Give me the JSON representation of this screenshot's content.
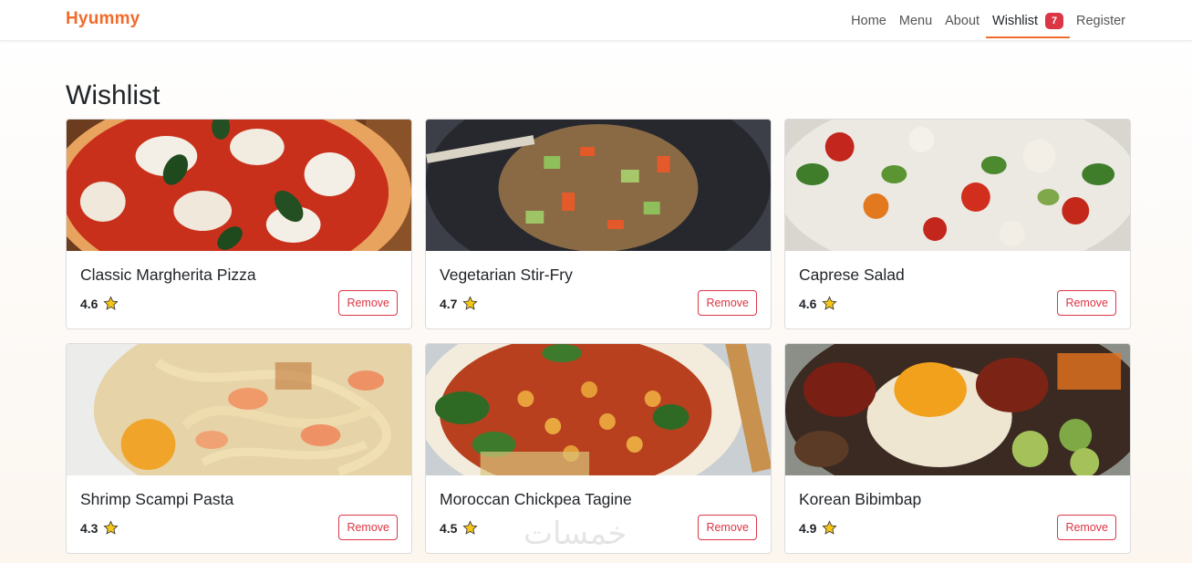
{
  "brand": "Hyummy",
  "nav": {
    "items": [
      "Home",
      "Menu",
      "About",
      "Wishlist",
      "Register"
    ],
    "wishlist_count": "7"
  },
  "page_title": "Wishlist",
  "cards": [
    {
      "title": "Classic Margherita Pizza",
      "rating": "4.6",
      "button": "Remove"
    },
    {
      "title": "Vegetarian Stir-Fry",
      "rating": "4.7",
      "button": "Remove"
    },
    {
      "title": "Caprese Salad",
      "rating": "4.6",
      "button": "Remove"
    },
    {
      "title": "Shrimp Scampi Pasta",
      "rating": "4.3",
      "button": "Remove"
    },
    {
      "title": "Moroccan Chickpea Tagine",
      "rating": "4.5",
      "button": "Remove"
    },
    {
      "title": "Korean Bibimbap",
      "rating": "4.9",
      "button": "Remove"
    }
  ],
  "watermark": "خمسات",
  "colors": {
    "brand": "#f26b2b",
    "danger": "#dc3545",
    "star": "#f5c518"
  }
}
